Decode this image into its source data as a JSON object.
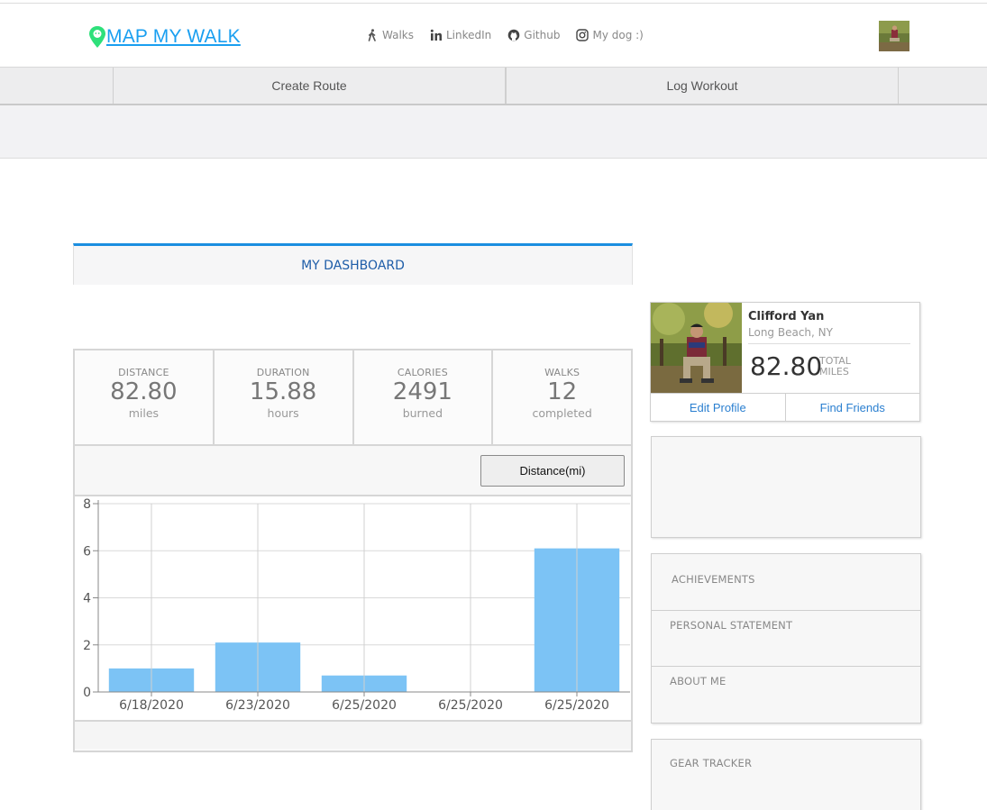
{
  "header": {
    "logo_text": "MAP MY WALK",
    "nav": [
      {
        "label": "Walks",
        "icon": "walking-icon"
      },
      {
        "label": "LinkedIn",
        "icon": "linkedin-icon"
      },
      {
        "label": "Github",
        "icon": "github-icon"
      },
      {
        "label": "My dog :)",
        "icon": "instagram-icon"
      }
    ]
  },
  "tabs": [
    {
      "label": "Create Route"
    },
    {
      "label": "Log Workout"
    }
  ],
  "dashboard": {
    "title": "MY DASHBOARD",
    "stats": [
      {
        "label": "DISTANCE",
        "value": "82.80",
        "unit": "miles"
      },
      {
        "label": "DURATION",
        "value": "15.88",
        "unit": "hours"
      },
      {
        "label": "CALORIES",
        "value": "2491",
        "unit": "burned"
      },
      {
        "label": "WALKS",
        "value": "12",
        "unit": "completed"
      }
    ],
    "metric_button": "Distance(mi)"
  },
  "chart_data": {
    "type": "bar",
    "categories": [
      "6/18/2020",
      "6/23/2020",
      "6/25/2020",
      "6/25/2020",
      "6/25/2020"
    ],
    "values": [
      1.0,
      2.1,
      0.7,
      0,
      6.1
    ],
    "ylim": [
      0,
      8
    ],
    "yticks": [
      "0",
      "2",
      "4",
      "6",
      "8"
    ],
    "grid": true,
    "bar_color": "#7cc3f5"
  },
  "profile": {
    "name": "Clifford Yan",
    "location": "Long Beach, NY",
    "total_miles": "82.80",
    "total_label_1": "TOTAL",
    "total_label_2": "MILES",
    "edit_label": "Edit Profile",
    "friends_label": "Find Friends"
  },
  "sections": {
    "achievements": "ACHIEVEMENTS",
    "personal_statement": "PERSONAL STATEMENT",
    "about_me": "ABOUT ME",
    "gear_tracker": "GEAR TRACKER"
  },
  "colors": {
    "brand": "#1a9ff0",
    "pin": "#2ee07a",
    "accent": "#1b8ee0",
    "link": "#2a7fd0"
  }
}
